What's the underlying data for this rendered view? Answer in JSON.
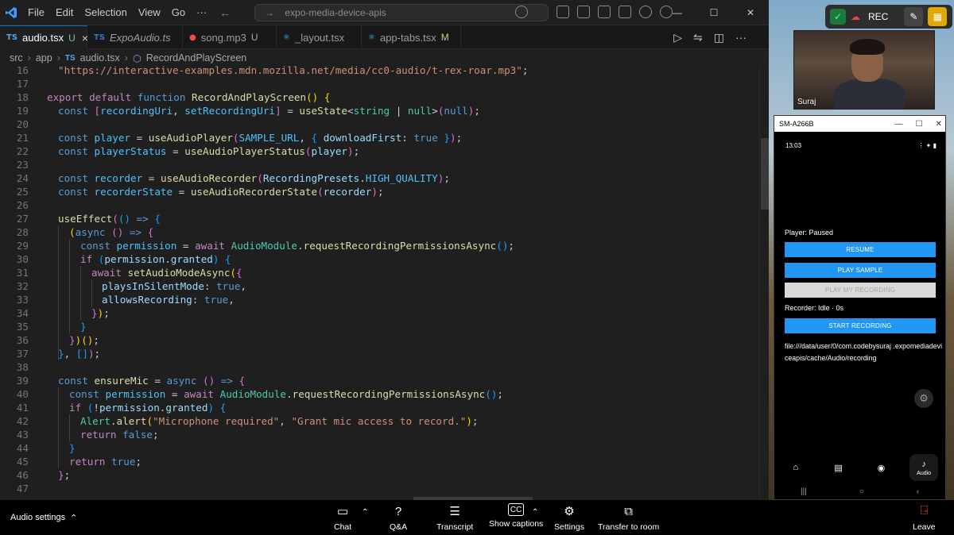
{
  "vscode": {
    "menu": [
      "File",
      "Edit",
      "Selection",
      "View",
      "Go"
    ],
    "menu_more": "···",
    "search_text": "expo-media-device-apis",
    "tabs": [
      {
        "label": "audio.tsx",
        "flag": "U",
        "icon": "TS",
        "icon_color": "#4fa8f0",
        "active": true,
        "close": "×"
      },
      {
        "label": "ExpoAudio.ts",
        "flag": "",
        "icon": "TS",
        "icon_color": "#3178c6",
        "italic": true
      },
      {
        "label": "song.mp3",
        "flag": "U",
        "icon": "●",
        "icon_color": "#f14c4c"
      },
      {
        "label": "_layout.tsx",
        "flag": "",
        "icon": "⚛",
        "icon_color": "#4fc1ff"
      },
      {
        "label": "app-tabs.tsx",
        "flag": "M",
        "icon": "⚛",
        "icon_color": "#4fc1ff"
      }
    ],
    "breadcrumb": [
      "src",
      "app",
      "audio.tsx",
      "RecordAndPlayScreen"
    ],
    "code_lines": [
      16,
      17,
      18,
      19,
      20,
      21,
      22,
      23,
      24,
      25,
      26,
      27,
      28,
      29,
      30,
      31,
      32,
      33,
      34,
      35,
      36,
      37,
      38,
      39,
      40,
      41,
      42,
      43,
      44,
      45,
      46,
      47
    ]
  },
  "code_text": {
    "l16": "\"https://interactive-examples.mdn.mozilla.net/media/cc0-audio/t-rex-roar.mp3\"",
    "url_tail": ";",
    "kw_export": "export",
    "kw_default": "default",
    "kw_function": "function",
    "fn_screen": "RecordAndPlayScreen",
    "kw_const": "const",
    "v_recordingUri": "recordingUri",
    "v_setRecordingUri": "setRecordingUri",
    "fn_useState": "useState",
    "t_string": "string",
    "t_null": "null",
    "v_player": "player",
    "fn_useAudioPlayer": "useAudioPlayer",
    "c_sample": "SAMPLE_URL",
    "v_downloadFirst": "downloadFirst",
    "kb_true": "true",
    "v_playerStatus": "playerStatus",
    "fn_useAudioPlayerStatus": "useAudioPlayerStatus",
    "v_recorder": "recorder",
    "fn_useAudioRecorder": "useAudioRecorder",
    "v_presets": "RecordingPresets",
    "c_hq": "HIGH_QUALITY",
    "v_recorderState": "recorderState",
    "fn_useAudioRecorderState": "useAudioRecorderState",
    "fn_useEffect": "useEffect",
    "kb_async": "async",
    "v_permission": "permission",
    "k_await": "await",
    "v_audiomodule": "AudioModule",
    "fn_reqperm": "requestRecordingPermissionsAsync",
    "k_if": "if",
    "v_granted": "granted",
    "fn_setmode": "setAudioModeAsync",
    "v_silent": "playsInSilentMode",
    "v_allows": "allowsRecording",
    "fn_ensureMic": "ensureMic",
    "v_alert": "Alert",
    "fn_alert": "alert",
    "s_mic": "\"Microphone required\"",
    "s_grant": "\"Grant mic access to record.\"",
    "k_return": "return",
    "kb_false": "false"
  },
  "emulator": {
    "window_title": "SM-A266B",
    "time": "13:03",
    "status_right": "⋮ ✦ ▮",
    "player_status": "Player: Paused",
    "btn_resume": "RESUME",
    "btn_play_sample": "PLAY SAMPLE",
    "btn_play_my_recording": "PLAY MY RECORDING",
    "recorder_status": "Recorder: Idle · 0s",
    "btn_start_recording": "START RECORDING",
    "file_path": "file:///data/user/0/com.codebysuraj .expomediadeviceapis/cache/Audio/recording",
    "nav_active_label": "Audio"
  },
  "meeting": {
    "rec_label": "REC",
    "camera_name": "Suraj",
    "audio_settings": "Audio settings",
    "items": [
      {
        "label": "Chat",
        "icon": "chat-icon"
      },
      {
        "label": "Q&A",
        "icon": "qa-icon"
      },
      {
        "label": "Transcript",
        "icon": "transcript-icon"
      },
      {
        "label": "Show captions",
        "icon": "captions-icon"
      },
      {
        "label": "Settings",
        "icon": "gear-icon"
      },
      {
        "label": "Transfer to room",
        "icon": "cast-icon"
      }
    ],
    "leave_label": "Leave"
  }
}
